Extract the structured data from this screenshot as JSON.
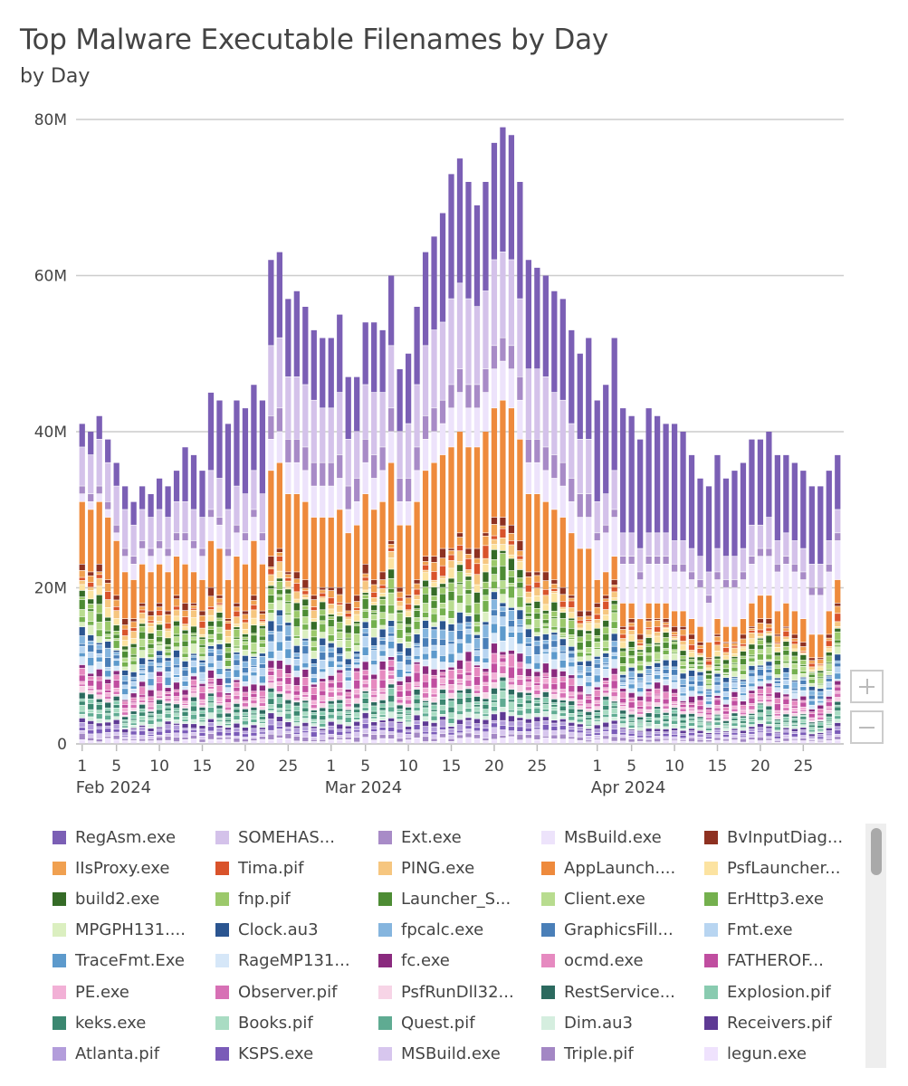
{
  "title": "Top Malware Executable Filenames by Day",
  "subtitle": "by Day",
  "controls": {
    "zoom_in": "+",
    "zoom_out": "−"
  },
  "chart_data": {
    "type": "bar",
    "stacked": true,
    "title": "Top Malware Executable Filenames by Day",
    "subtitle": "by Day",
    "xlabel": "",
    "ylabel": "",
    "ylim": [
      0,
      80000000
    ],
    "yticks": [
      0,
      20000000,
      40000000,
      60000000,
      80000000
    ],
    "ytick_labels": [
      "0",
      "20M",
      "40M",
      "60M",
      "80M"
    ],
    "grid": true,
    "legend_position": "bottom",
    "x_tick_labels": [
      {
        "day_index": 0,
        "label": "1"
      },
      {
        "day_index": 4,
        "label": "5"
      },
      {
        "day_index": 9,
        "label": "10"
      },
      {
        "day_index": 14,
        "label": "15"
      },
      {
        "day_index": 19,
        "label": "20"
      },
      {
        "day_index": 24,
        "label": "25"
      },
      {
        "day_index": 29,
        "label": "1"
      },
      {
        "day_index": 33,
        "label": "5"
      },
      {
        "day_index": 38,
        "label": "10"
      },
      {
        "day_index": 43,
        "label": "15"
      },
      {
        "day_index": 48,
        "label": "20"
      },
      {
        "day_index": 53,
        "label": "25"
      },
      {
        "day_index": 60,
        "label": "1"
      },
      {
        "day_index": 64,
        "label": "5"
      },
      {
        "day_index": 69,
        "label": "10"
      },
      {
        "day_index": 74,
        "label": "15"
      },
      {
        "day_index": 79,
        "label": "20"
      },
      {
        "day_index": 84,
        "label": "25"
      }
    ],
    "month_labels": [
      {
        "day_index": 0,
        "label": "Feb 2024"
      },
      {
        "day_index": 29,
        "label": "Mar 2024"
      },
      {
        "day_index": 60,
        "label": "Apr 2024"
      }
    ],
    "x": [
      "2024-02-01",
      "2024-02-02",
      "2024-02-03",
      "2024-02-04",
      "2024-02-05",
      "2024-02-06",
      "2024-02-07",
      "2024-02-08",
      "2024-02-09",
      "2024-02-10",
      "2024-02-11",
      "2024-02-12",
      "2024-02-13",
      "2024-02-14",
      "2024-02-15",
      "2024-02-16",
      "2024-02-17",
      "2024-02-18",
      "2024-02-19",
      "2024-02-20",
      "2024-02-21",
      "2024-02-22",
      "2024-02-23",
      "2024-02-24",
      "2024-02-25",
      "2024-02-26",
      "2024-02-27",
      "2024-02-28",
      "2024-02-29",
      "2024-03-01",
      "2024-03-02",
      "2024-03-03",
      "2024-03-04",
      "2024-03-05",
      "2024-03-06",
      "2024-03-07",
      "2024-03-08",
      "2024-03-09",
      "2024-03-10",
      "2024-03-11",
      "2024-03-12",
      "2024-03-13",
      "2024-03-14",
      "2024-03-15",
      "2024-03-16",
      "2024-03-17",
      "2024-03-18",
      "2024-03-19",
      "2024-03-20",
      "2024-03-21",
      "2024-03-22",
      "2024-03-23",
      "2024-03-24",
      "2024-03-25",
      "2024-03-26",
      "2024-03-27",
      "2024-03-28",
      "2024-03-29",
      "2024-03-30",
      "2024-03-31",
      "2024-04-01",
      "2024-04-02",
      "2024-04-03",
      "2024-04-04",
      "2024-04-05",
      "2024-04-06",
      "2024-04-07",
      "2024-04-08",
      "2024-04-09",
      "2024-04-10",
      "2024-04-11",
      "2024-04-12",
      "2024-04-13",
      "2024-04-14",
      "2024-04-15",
      "2024-04-16",
      "2024-04-17",
      "2024-04-18",
      "2024-04-19",
      "2024-04-20",
      "2024-04-21",
      "2024-04-22",
      "2024-04-23",
      "2024-04-24",
      "2024-04-25",
      "2024-04-26",
      "2024-04-27",
      "2024-04-28",
      "2024-04-29"
    ],
    "totals_millions": [
      41,
      40,
      42,
      39,
      36,
      33,
      31,
      33,
      32,
      34,
      33,
      35,
      38,
      37,
      35,
      45,
      44,
      41,
      44,
      43,
      46,
      44,
      62,
      63,
      57,
      58,
      56,
      53,
      52,
      52,
      55,
      47,
      47,
      54,
      54,
      53,
      60,
      48,
      50,
      56,
      63,
      65,
      68,
      73,
      75,
      72,
      69,
      72,
      77,
      79,
      78,
      72,
      62,
      61,
      60,
      58,
      57,
      53,
      50,
      52,
      44,
      46,
      52,
      43,
      42,
      39,
      43,
      42,
      41,
      41,
      40,
      37,
      34,
      33,
      37,
      34,
      35,
      36,
      39,
      39,
      40,
      37,
      37,
      36,
      35,
      33,
      33,
      35,
      37
    ],
    "series_top_segments_millions": {
      "RegAsm.exe": [
        3,
        3,
        3,
        3,
        3,
        3,
        3,
        3,
        3,
        4,
        4,
        4,
        7,
        7,
        6,
        10,
        10,
        11,
        11,
        11,
        11,
        12,
        11,
        11,
        10,
        11,
        10,
        9,
        9,
        9,
        10,
        8,
        7,
        8,
        9,
        8,
        9,
        8,
        9,
        10,
        12,
        12,
        14,
        16,
        16,
        15,
        13,
        14,
        15,
        16,
        16,
        15,
        14,
        13,
        13,
        13,
        13,
        12,
        11,
        13,
        13,
        14,
        17,
        16,
        15,
        14,
        16,
        15,
        14,
        15,
        14,
        12,
        10,
        11,
        12,
        10,
        11,
        11,
        11,
        11,
        11,
        11,
        10,
        10,
        10,
        10,
        10,
        9,
        7
      ],
      "SOMEHAS...": [
        5,
        5,
        6,
        5,
        5,
        5,
        4,
        4,
        4,
        4,
        4,
        4,
        4,
        4,
        4,
        5,
        5,
        5,
        5,
        5,
        5,
        5,
        9,
        9,
        8,
        8,
        8,
        8,
        7,
        7,
        8,
        6,
        6,
        7,
        8,
        7,
        8,
        6,
        7,
        8,
        9,
        10,
        10,
        11,
        11,
        11,
        10,
        10,
        11,
        11,
        11,
        10,
        9,
        9,
        9,
        8,
        8,
        7,
        7,
        7,
        4,
        4,
        5,
        3,
        3,
        3,
        3,
        3,
        3,
        3,
        3,
        3,
        3,
        3,
        3,
        3,
        3,
        3,
        4,
        3,
        4,
        3,
        3,
        3,
        3,
        3,
        3,
        3,
        3
      ],
      "Ext.exe": [
        1,
        1,
        1,
        1,
        1,
        1,
        1,
        1,
        1,
        1,
        1,
        1,
        1,
        1,
        1,
        1,
        1,
        1,
        1,
        1,
        1,
        1,
        3,
        3,
        3,
        3,
        3,
        3,
        3,
        3,
        3,
        3,
        3,
        3,
        3,
        3,
        3,
        3,
        3,
        3,
        3,
        3,
        3,
        3,
        3,
        3,
        3,
        3,
        3,
        3,
        3,
        3,
        3,
        3,
        3,
        3,
        3,
        3,
        3,
        3,
        1,
        1,
        1,
        1,
        1,
        1,
        1,
        1,
        1,
        1,
        1,
        1,
        1,
        1,
        1,
        1,
        1,
        1,
        1,
        1,
        1,
        1,
        1,
        1,
        1,
        1,
        1,
        1,
        1
      ],
      "MsBuild.exe": [
        1,
        1,
        1,
        1,
        1,
        2,
        2,
        2,
        2,
        2,
        2,
        2,
        3,
        3,
        3,
        3,
        3,
        3,
        3,
        3,
        3,
        3,
        4,
        4,
        4,
        4,
        4,
        4,
        4,
        4,
        4,
        3,
        3,
        4,
        4,
        4,
        4,
        3,
        3,
        4,
        4,
        4,
        4,
        5,
        5,
        5,
        5,
        5,
        5,
        5,
        5,
        5,
        4,
        4,
        4,
        4,
        4,
        4,
        4,
        4,
        5,
        5,
        5,
        5,
        5,
        5,
        5,
        5,
        5,
        5,
        5,
        5,
        5,
        5,
        5,
        5,
        5,
        5,
        5,
        5,
        5,
        5,
        5,
        5,
        5,
        5,
        5,
        5,
        5
      ],
      "AppLaunch....": [
        8,
        8,
        8,
        8,
        7,
        6,
        5,
        5,
        5,
        5,
        5,
        5,
        5,
        4,
        4,
        6,
        6,
        5,
        6,
        6,
        7,
        6,
        11,
        11,
        10,
        10,
        10,
        10,
        9,
        9,
        10,
        9,
        9,
        9,
        9,
        9,
        10,
        8,
        9,
        10,
        11,
        12,
        12,
        13,
        13,
        13,
        13,
        13,
        14,
        15,
        15,
        13,
        10,
        10,
        9,
        9,
        9,
        8,
        8,
        8,
        3,
        3,
        3,
        3,
        2,
        2,
        2,
        2,
        2,
        2,
        2,
        2,
        2,
        2,
        2,
        2,
        2,
        2,
        3,
        3,
        3,
        3,
        3,
        3,
        3,
        3,
        3,
        3,
        3
      ]
    },
    "series": [
      {
        "name": "RegAsm.exe",
        "color": "#7b5fb5"
      },
      {
        "name": "SOMEHAS...",
        "color": "#d4c2ea"
      },
      {
        "name": "Ext.exe",
        "color": "#a88bc7"
      },
      {
        "name": "MsBuild.exe",
        "color": "#ede3fb"
      },
      {
        "name": "BvInputDiag...",
        "color": "#8e3121"
      },
      {
        "name": "IIsProxy.exe",
        "color": "#f0a050"
      },
      {
        "name": "Tima.pif",
        "color": "#d9532b"
      },
      {
        "name": "PING.exe",
        "color": "#f6c67f"
      },
      {
        "name": "AppLaunch....",
        "color": "#ee8a3c"
      },
      {
        "name": "PsfLauncher...",
        "color": "#fce3a1"
      },
      {
        "name": "build2.exe",
        "color": "#356b27"
      },
      {
        "name": "fnp.pif",
        "color": "#9cc96b"
      },
      {
        "name": "Launcher_S...",
        "color": "#4d8c34"
      },
      {
        "name": "Client.exe",
        "color": "#b8dc8f"
      },
      {
        "name": "ErHttp3.exe",
        "color": "#74b04e"
      },
      {
        "name": "MPGPH131....",
        "color": "#dbefc0"
      },
      {
        "name": "Clock.au3",
        "color": "#2b5590"
      },
      {
        "name": "fpcalc.exe",
        "color": "#85b5de"
      },
      {
        "name": "GraphicsFill...",
        "color": "#4a7fb8"
      },
      {
        "name": "Fmt.exe",
        "color": "#b8d5f1"
      },
      {
        "name": "TraceFmt.Exe",
        "color": "#5d9acc"
      },
      {
        "name": "RageMP131...",
        "color": "#d6e7f8"
      },
      {
        "name": "fc.exe",
        "color": "#8a2a7e"
      },
      {
        "name": "ocmd.exe",
        "color": "#e68ac0"
      },
      {
        "name": "FATHEROF...",
        "color": "#c04ea0"
      },
      {
        "name": "PE.exe",
        "color": "#f2b0d6"
      },
      {
        "name": "Observer.pif",
        "color": "#d770b5"
      },
      {
        "name": "PsfRunDll32...",
        "color": "#f7d4e6"
      },
      {
        "name": "RestService...",
        "color": "#2c6a5f"
      },
      {
        "name": "Explosion.pif",
        "color": "#89cbb0"
      },
      {
        "name": "keks.exe",
        "color": "#3b8770"
      },
      {
        "name": "Books.pif",
        "color": "#a9dcc3"
      },
      {
        "name": "Quest.pif",
        "color": "#5fab92"
      },
      {
        "name": "Dim.au3",
        "color": "#d5eedf"
      },
      {
        "name": "Receivers.pif",
        "color": "#5e3a94"
      },
      {
        "name": "Atlanta.pif",
        "color": "#b39ddb"
      },
      {
        "name": "KSPS.exe",
        "color": "#7a5bb8"
      },
      {
        "name": "MSBuild.exe",
        "color": "#d7c6ee"
      },
      {
        "name": "Triple.pif",
        "color": "#a387c4"
      },
      {
        "name": "legun.exe",
        "color": "#efe2fd"
      }
    ]
  }
}
